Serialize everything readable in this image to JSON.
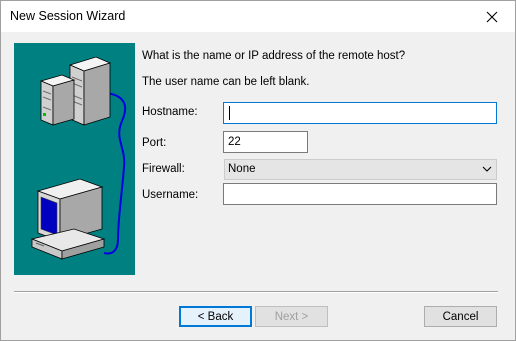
{
  "window": {
    "title": "New Session Wizard",
    "close_icon": "close-icon"
  },
  "illustration": {
    "description_icon": "network-computers-icon",
    "background": "#008080"
  },
  "prompt": {
    "line1": "What is the name or IP address of the remote host?",
    "line2": "The user name can be left blank."
  },
  "form": {
    "hostname": {
      "label": "Hostname:",
      "value": ""
    },
    "port": {
      "label": "Port:",
      "value": "22"
    },
    "firewall": {
      "label": "Firewall:",
      "value": "None",
      "arrow_icon": "chevron-down-icon"
    },
    "username": {
      "label": "Username:",
      "value": ""
    }
  },
  "buttons": {
    "back": "< Back",
    "next": "Next >",
    "cancel": "Cancel"
  },
  "colors": {
    "focus": "#0078d7",
    "teal": "#008080"
  }
}
